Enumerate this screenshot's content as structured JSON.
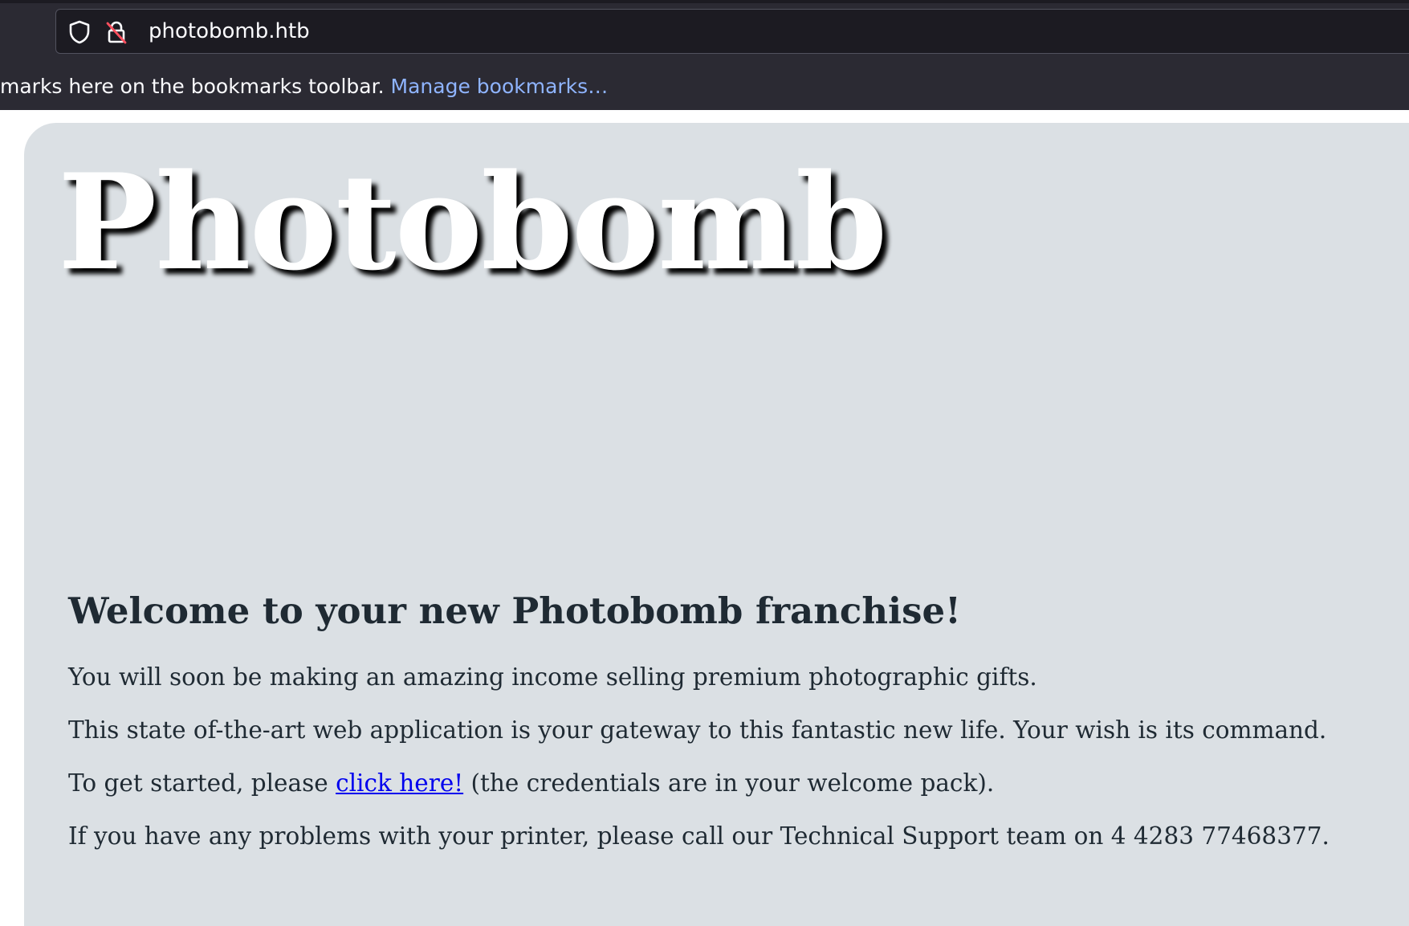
{
  "browser": {
    "url": "photobomb.htb",
    "bookmarks_text": "marks here on the bookmarks toolbar.",
    "bookmarks_link": "Manage bookmarks…"
  },
  "page": {
    "hero_title": "Photobomb",
    "heading": "Welcome to your new Photobomb franchise!",
    "p1": "You will soon be making an amazing income selling premium photographic gifts.",
    "p2": "This state of-the-art web application is your gateway to this fantastic new life. Your wish is its command.",
    "p3_before": "To get started, please",
    "p3_link": "click here!",
    "p3_after": "(the credentials are in your welcome pack).",
    "p4": "If you have any problems with your printer, please call our Technical Support team on 4 4283 77468377."
  },
  "colors": {
    "browser_chrome": "#2b2a33",
    "urlbar": "#1c1b22",
    "panel_background": "#dbe0e4",
    "text": "#1f2a33",
    "link": "#0000ee",
    "bookmarks_link": "#8fb4ff"
  },
  "icons": {
    "tracking_protection": "shield-icon",
    "connection_security": "insecure-lock-icon"
  }
}
